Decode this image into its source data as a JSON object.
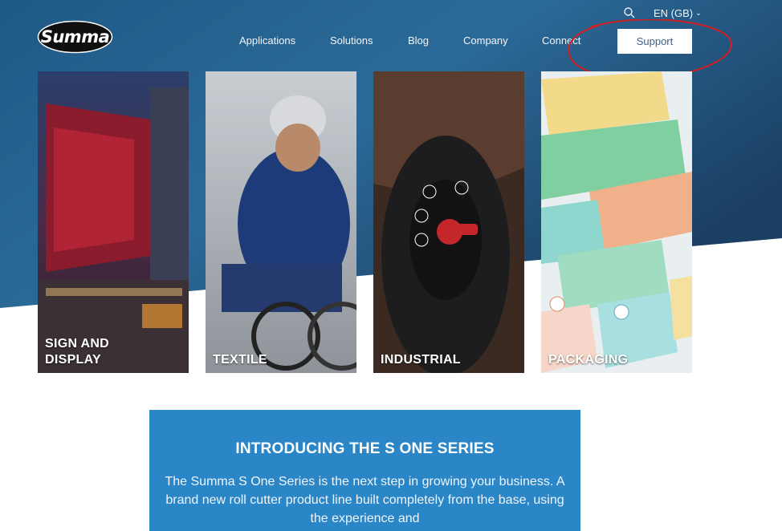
{
  "logo": {
    "text": "Summa"
  },
  "topbar": {
    "language": "EN (GB)"
  },
  "nav": {
    "items": [
      "Applications",
      "Solutions",
      "Blog",
      "Company",
      "Connect"
    ],
    "support_label": "Support"
  },
  "tiles": [
    {
      "label": "SIGN AND\nDISPLAY"
    },
    {
      "label": "TEXTILE"
    },
    {
      "label": "INDUSTRIAL"
    },
    {
      "label": "PACKAGING"
    }
  ],
  "intro": {
    "title": "INTRODUCING THE S ONE SERIES",
    "body": "The Summa S One Series is the next step in growing your business. A brand new roll cutter product line built completely from the base, using the experience and"
  },
  "colors": {
    "hero_dark": "#1c4f7a",
    "hero_light": "#2d6f9e",
    "intro_box": "#2a86c6",
    "annotation_red": "#d21e22"
  }
}
